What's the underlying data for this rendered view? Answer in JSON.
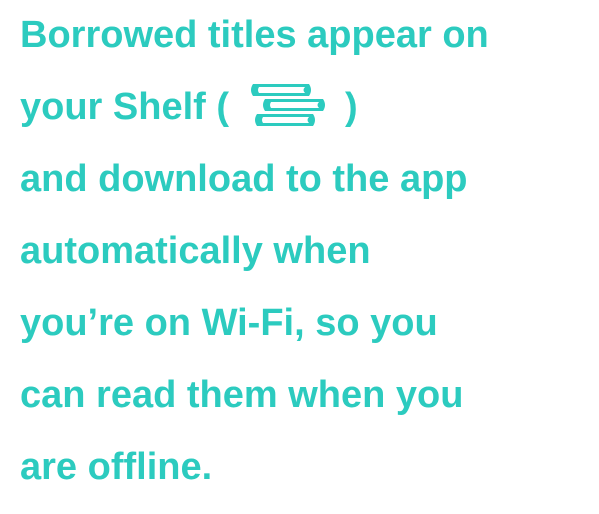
{
  "message": {
    "line1": "Borrowed titles appear on",
    "line2_before_icon": "your Shelf (",
    "line2_after_icon": ")",
    "line3": "and download to the app",
    "line4": "automatically when",
    "line5": "you’re on Wi-Fi, so you",
    "line6": "can read them when you",
    "line7": "are offline."
  },
  "icons": {
    "shelf_icon": "books-stack-icon"
  },
  "colors": {
    "text": "#2ccbbf",
    "icon_fill": "#2ccbbf",
    "background": "#ffffff"
  }
}
